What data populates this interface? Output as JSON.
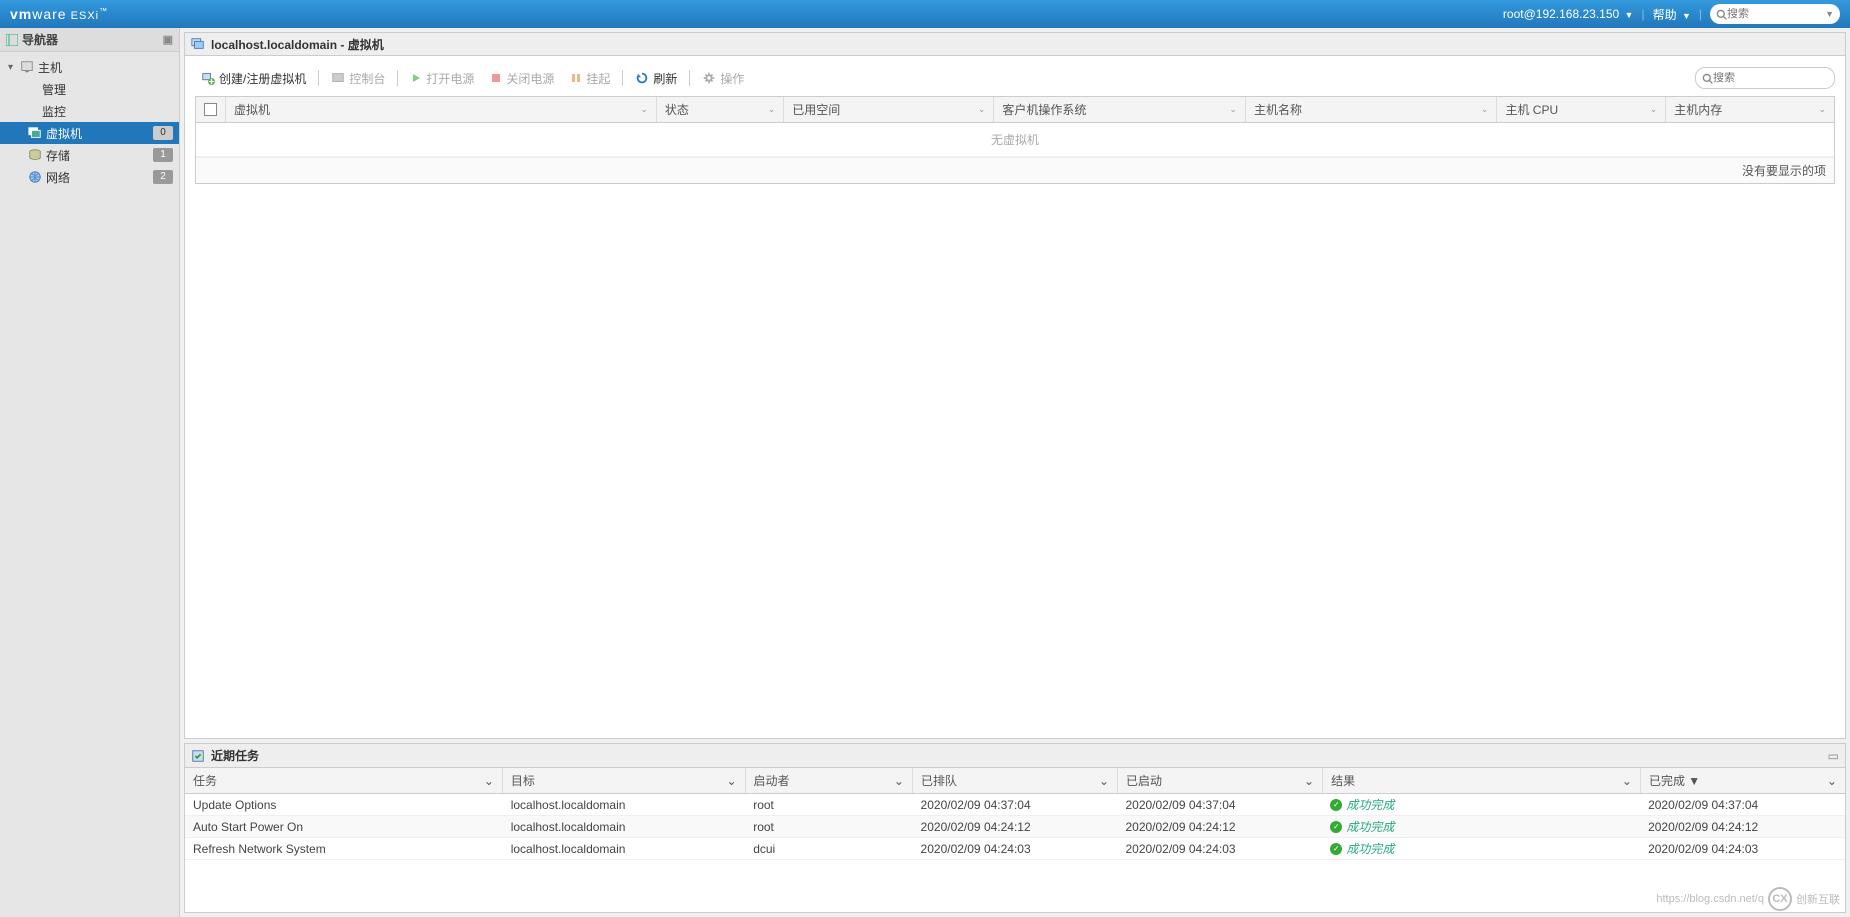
{
  "topbar": {
    "logo_vm": "vm",
    "logo_ware": "ware",
    "logo_esxi": " ESXi",
    "user": "root@192.168.23.150",
    "help": "帮助",
    "search_placeholder": "搜索"
  },
  "sidebar": {
    "title": "导航器",
    "host": "主机",
    "manage": "管理",
    "monitor": "监控",
    "vm": "虚拟机",
    "vm_count": "0",
    "storage": "存储",
    "storage_count": "1",
    "network": "网络",
    "network_count": "2"
  },
  "vm_panel": {
    "title": "localhost.localdomain - 虚拟机",
    "toolbar": {
      "create": "创建/注册虚拟机",
      "console": "控制台",
      "poweron": "打开电源",
      "poweroff": "关闭电源",
      "suspend": "挂起",
      "refresh": "刷新",
      "actions": "操作",
      "search_placeholder": "搜索"
    },
    "columns": {
      "vm": "虚拟机",
      "status": "状态",
      "space": "已用空间",
      "guest": "客户机操作系统",
      "hostname": "主机名称",
      "cpu": "主机 CPU",
      "mem": "主机内存"
    },
    "empty": "无虚拟机",
    "footer": "没有要显示的项"
  },
  "tasks_panel": {
    "title": "近期任务",
    "columns": {
      "task": "任务",
      "target": "目标",
      "initiator": "启动者",
      "queued": "已排队",
      "started": "已启动",
      "result": "结果",
      "completed": "已完成 ▼"
    },
    "rows": [
      {
        "task": "Update Options",
        "target": "localhost.localdomain",
        "initiator": "root",
        "queued": "2020/02/09 04:37:04",
        "started": "2020/02/09 04:37:04",
        "result": "成功完成",
        "completed": "2020/02/09 04:37:04"
      },
      {
        "task": "Auto Start Power On",
        "target": "localhost.localdomain",
        "initiator": "root",
        "queued": "2020/02/09 04:24:12",
        "started": "2020/02/09 04:24:12",
        "result": "成功完成",
        "completed": "2020/02/09 04:24:12"
      },
      {
        "task": "Refresh Network System",
        "target": "localhost.localdomain",
        "initiator": "dcui",
        "queued": "2020/02/09 04:24:03",
        "started": "2020/02/09 04:24:03",
        "result": "成功完成",
        "completed": "2020/02/09 04:24:03"
      }
    ]
  },
  "watermark": {
    "url": "https://blog.csdn.net/q",
    "brand": "创新互联"
  }
}
